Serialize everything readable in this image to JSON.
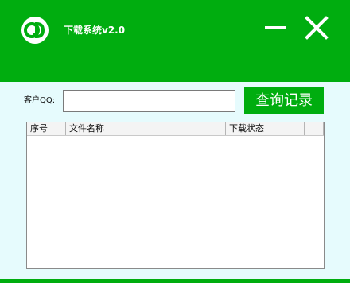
{
  "window": {
    "title": "下载系统v2.0",
    "accent_color": "#00ad0f",
    "logo_icon": "qd-logo-icon",
    "minimize_icon": "minimize-icon",
    "close_icon": "close-icon"
  },
  "form": {
    "qq_label": "客户QQ:",
    "qq_value": "",
    "query_button_label": "查询记录"
  },
  "table": {
    "columns": [
      "序号",
      "文件名称",
      "下载状态",
      ""
    ],
    "rows": []
  }
}
